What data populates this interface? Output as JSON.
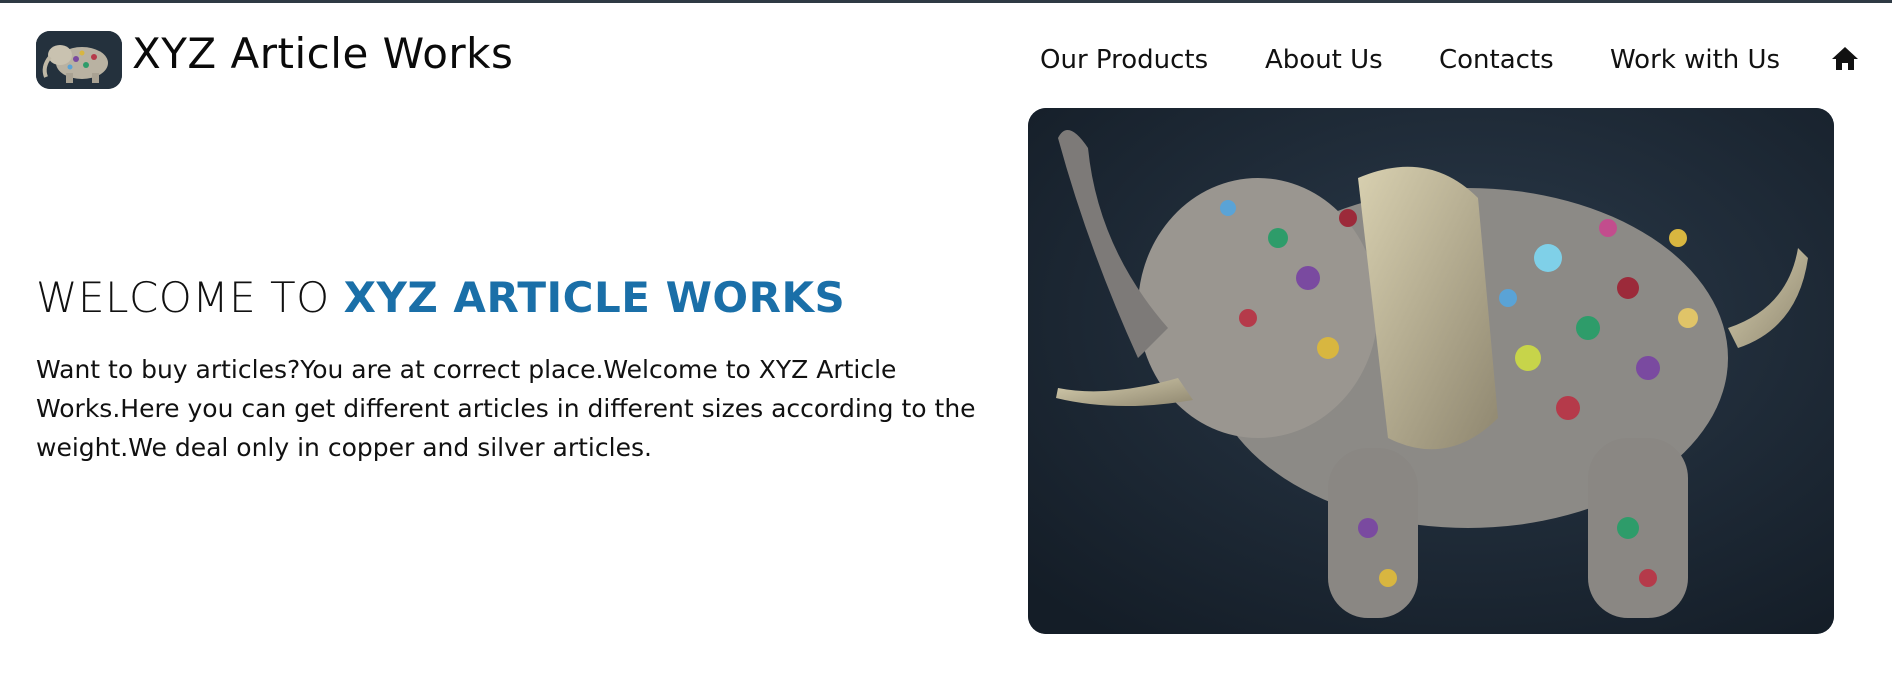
{
  "header": {
    "brand": "XYZ Article Works",
    "logo_icon": "elephant-logo-icon"
  },
  "nav": {
    "items": [
      {
        "label": "Our Products"
      },
      {
        "label": "About Us"
      },
      {
        "label": "Contacts"
      },
      {
        "label": "Work with Us"
      }
    ],
    "home_icon": "home-icon"
  },
  "hero": {
    "welcome_prefix": "WELCOME TO",
    "welcome_highlight": "XYZ ARTICLE WORKS",
    "intro": "Want to buy articles?You are at correct place.Welcome to XYZ Article Works.Here you can get different articles in different sizes according to the weight.We deal only in copper and silver articles."
  },
  "colors": {
    "accent": "#1a6fa8",
    "top_border": "#2f3a44"
  }
}
